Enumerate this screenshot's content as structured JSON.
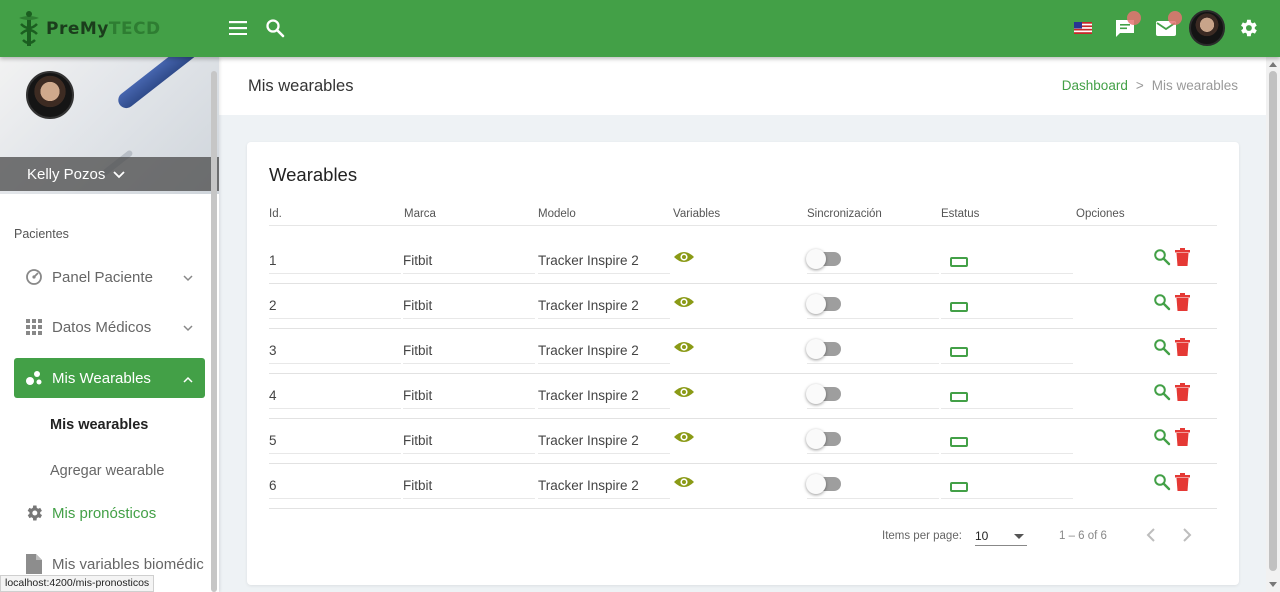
{
  "brand": {
    "name_part1": "PreMy",
    "name_part2": "TECD"
  },
  "topbar": {
    "menu_icon": "menu-icon",
    "search_icon": "search-icon",
    "flag_icon": "us-flag-icon",
    "chat_icon": "chat-icon",
    "mail_icon": "mail-icon",
    "settings_icon": "gear-icon"
  },
  "sidebar": {
    "user_name": "Kelly Pozos",
    "section_label": "Pacientes",
    "items": [
      {
        "label": "Panel Paciente",
        "icon": "dashboard-icon"
      },
      {
        "label": "Datos Médicos",
        "icon": "grid-icon"
      },
      {
        "label": "Mis Wearables",
        "icon": "bubbles-icon"
      }
    ],
    "subitems": [
      {
        "label": "Mis wearables"
      },
      {
        "label": "Agregar wearable"
      }
    ],
    "more_items": [
      {
        "label": "Mis pronósticos",
        "icon": "gear-icon"
      },
      {
        "label": "Mis variables biomédic",
        "icon": "document-icon"
      }
    ]
  },
  "header": {
    "title": "Mis wearables",
    "breadcrumb": {
      "link": "Dashboard",
      "separator": ">",
      "current": "Mis wearables"
    }
  },
  "card": {
    "title": "Wearables",
    "columns": [
      "Id.",
      "Marca",
      "Modelo",
      "Variables",
      "Sincronización",
      "Estatus",
      "Opciones"
    ],
    "rows": [
      {
        "id": "1",
        "marca": "Fitbit",
        "modelo": "Tracker Inspire 2",
        "sync": false
      },
      {
        "id": "2",
        "marca": "Fitbit",
        "modelo": "Tracker Inspire 2",
        "sync": false
      },
      {
        "id": "3",
        "marca": "Fitbit",
        "modelo": "Tracker Inspire 2",
        "sync": false
      },
      {
        "id": "4",
        "marca": "Fitbit",
        "modelo": "Tracker Inspire 2",
        "sync": false
      },
      {
        "id": "5",
        "marca": "Fitbit",
        "modelo": "Tracker Inspire 2",
        "sync": false
      },
      {
        "id": "6",
        "marca": "Fitbit",
        "modelo": "Tracker Inspire 2",
        "sync": false
      }
    ],
    "paginator": {
      "items_per_page_label": "Items per page:",
      "items_per_page_value": "10",
      "range": "1 – 6 of 6"
    }
  },
  "status_bar": {
    "url": "localhost:4200/mis-pronosticos"
  },
  "colors": {
    "brand_green": "#43a047",
    "eye_color": "#8a9a16",
    "delete_red": "#e53935"
  }
}
